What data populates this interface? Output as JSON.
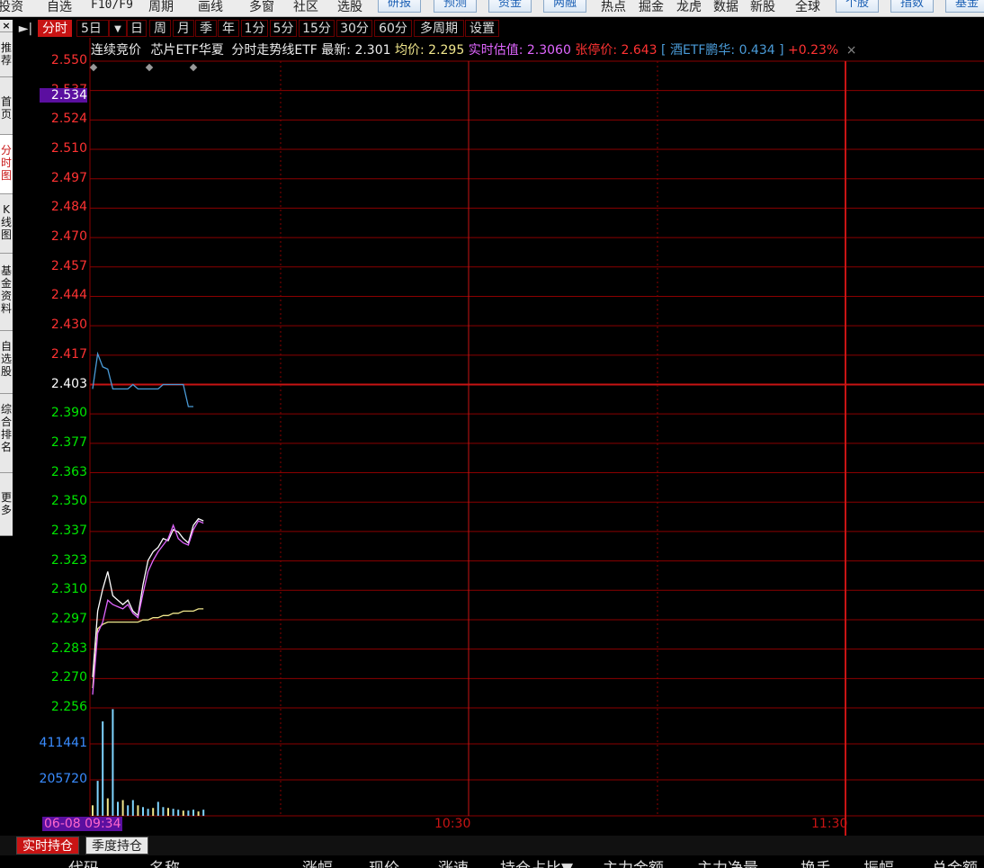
{
  "top_menu": {
    "items": [
      "投资",
      "自选",
      "F10/F9",
      "周期",
      "画线",
      "多窗",
      "社区",
      "选股",
      "热点",
      "掘金",
      "龙虎",
      "数据",
      "新股",
      "全球"
    ],
    "buttons": [
      "研报",
      "预测",
      "资金",
      "两融",
      "个股",
      "指数",
      "基金"
    ]
  },
  "toolbar": {
    "nav_icon": "►|",
    "items": [
      "分时",
      "5日",
      "日",
      "周",
      "月",
      "季",
      "年",
      "1分",
      "5分",
      "15分",
      "30分",
      "60分",
      "多周期",
      "设置"
    ],
    "dropdown_icon": "chevron-down-icon",
    "active": "分时"
  },
  "side_nav": {
    "items": [
      "推荐",
      "首页",
      "分时图",
      "K线图",
      "基金资料",
      "自选股",
      "综合排名",
      "更多"
    ],
    "active_index": 2
  },
  "info_line": {
    "status": "连续竞价",
    "name": "芯片ETF华夏",
    "chart_label": "分时走势线ETF",
    "latest_label": "最新:",
    "latest_value": "2.301",
    "avg_label": "均价:",
    "avg_value": "2.295",
    "est_label": "实时估值:",
    "est_value": "2.3060",
    "limit_label": "张停价:",
    "limit_value": "2.643",
    "compare_label": "[ 酒ETF鹏华: 0.434 ]",
    "change": "+0.23%",
    "close_icon": "×"
  },
  "price_axis": {
    "labels": [
      "2.550",
      "2.537",
      "2.524",
      "2.510",
      "2.497",
      "2.484",
      "2.470",
      "2.457",
      "2.444",
      "2.430",
      "2.417",
      "2.403",
      "2.390",
      "2.377",
      "2.363",
      "2.350",
      "2.337",
      "2.323",
      "2.310",
      "2.297",
      "2.283",
      "2.270",
      "2.256"
    ],
    "highlight": "2.534",
    "prev_close": "2.403"
  },
  "volume_axis": {
    "labels": [
      "411441",
      "205720"
    ]
  },
  "time_axis": {
    "start": "06-08 09:34",
    "labels": [
      "10:30",
      "11:30"
    ]
  },
  "colors": {
    "up": "#FF3232",
    "down": "#00E600",
    "grid": "#8B0000",
    "price_line": "#FFFFFF",
    "avg_line": "#F0E68C",
    "estimate_line": "#E066FF",
    "compare_line": "#4A9BD8",
    "highlight_bg": "#5B0FA0"
  },
  "chart_data": {
    "type": "line",
    "x": [
      "09:30",
      "09:31",
      "09:32",
      "09:33",
      "09:34",
      "09:35",
      "09:36",
      "09:37",
      "09:38",
      "09:39",
      "09:40",
      "09:41",
      "09:42",
      "09:43",
      "09:44",
      "09:45",
      "09:46",
      "09:47",
      "09:48",
      "09:49",
      "09:50",
      "09:51",
      "09:52",
      "09:53",
      "09:54"
    ],
    "ylim": [
      2.256,
      2.55
    ],
    "prev_close": 2.403,
    "series": [
      {
        "name": "最新",
        "color": "#FFFFFF",
        "values": [
          2.27,
          2.3,
          2.31,
          2.318,
          2.307,
          2.305,
          2.303,
          2.305,
          2.3,
          2.298,
          2.312,
          2.323,
          2.327,
          2.329,
          2.333,
          2.332,
          2.337,
          2.336,
          2.333,
          2.331,
          2.339,
          2.342,
          2.341,
          null,
          null
        ]
      },
      {
        "name": "均价",
        "color": "#F0E68C",
        "values": [
          2.265,
          2.292,
          2.294,
          2.295,
          2.295,
          2.295,
          2.295,
          2.295,
          2.295,
          2.295,
          2.296,
          2.296,
          2.297,
          2.297,
          2.298,
          2.298,
          2.299,
          2.299,
          2.3,
          2.3,
          2.3,
          2.301,
          2.301,
          null,
          null
        ]
      },
      {
        "name": "实时估值",
        "color": "#E066FF",
        "values": [
          2.262,
          2.29,
          2.295,
          2.305,
          2.303,
          2.302,
          2.301,
          2.303,
          2.299,
          2.297,
          2.308,
          2.318,
          2.323,
          2.327,
          2.33,
          2.333,
          2.339,
          2.333,
          2.331,
          2.33,
          2.337,
          2.341,
          2.34,
          null,
          null
        ]
      },
      {
        "name": "酒ETF鹏华",
        "color": "#4A9BD8",
        "values": [
          2.401,
          2.417,
          2.411,
          2.41,
          2.401,
          2.401,
          2.401,
          2.401,
          2.403,
          2.401,
          2.401,
          2.401,
          2.401,
          2.401,
          2.403,
          2.403,
          2.403,
          2.403,
          2.403,
          2.393,
          2.393,
          null,
          null,
          null,
          null
        ]
      }
    ],
    "volume": {
      "ylim": [
        0,
        617161
      ],
      "values": [
        60000,
        200000,
        540000,
        100000,
        610000,
        80000,
        90000,
        60000,
        90000,
        60000,
        50000,
        40000,
        45000,
        80000,
        50000,
        45000,
        40000,
        35000,
        30000,
        30000,
        35000,
        25000,
        35000,
        0,
        0
      ]
    }
  }
}
